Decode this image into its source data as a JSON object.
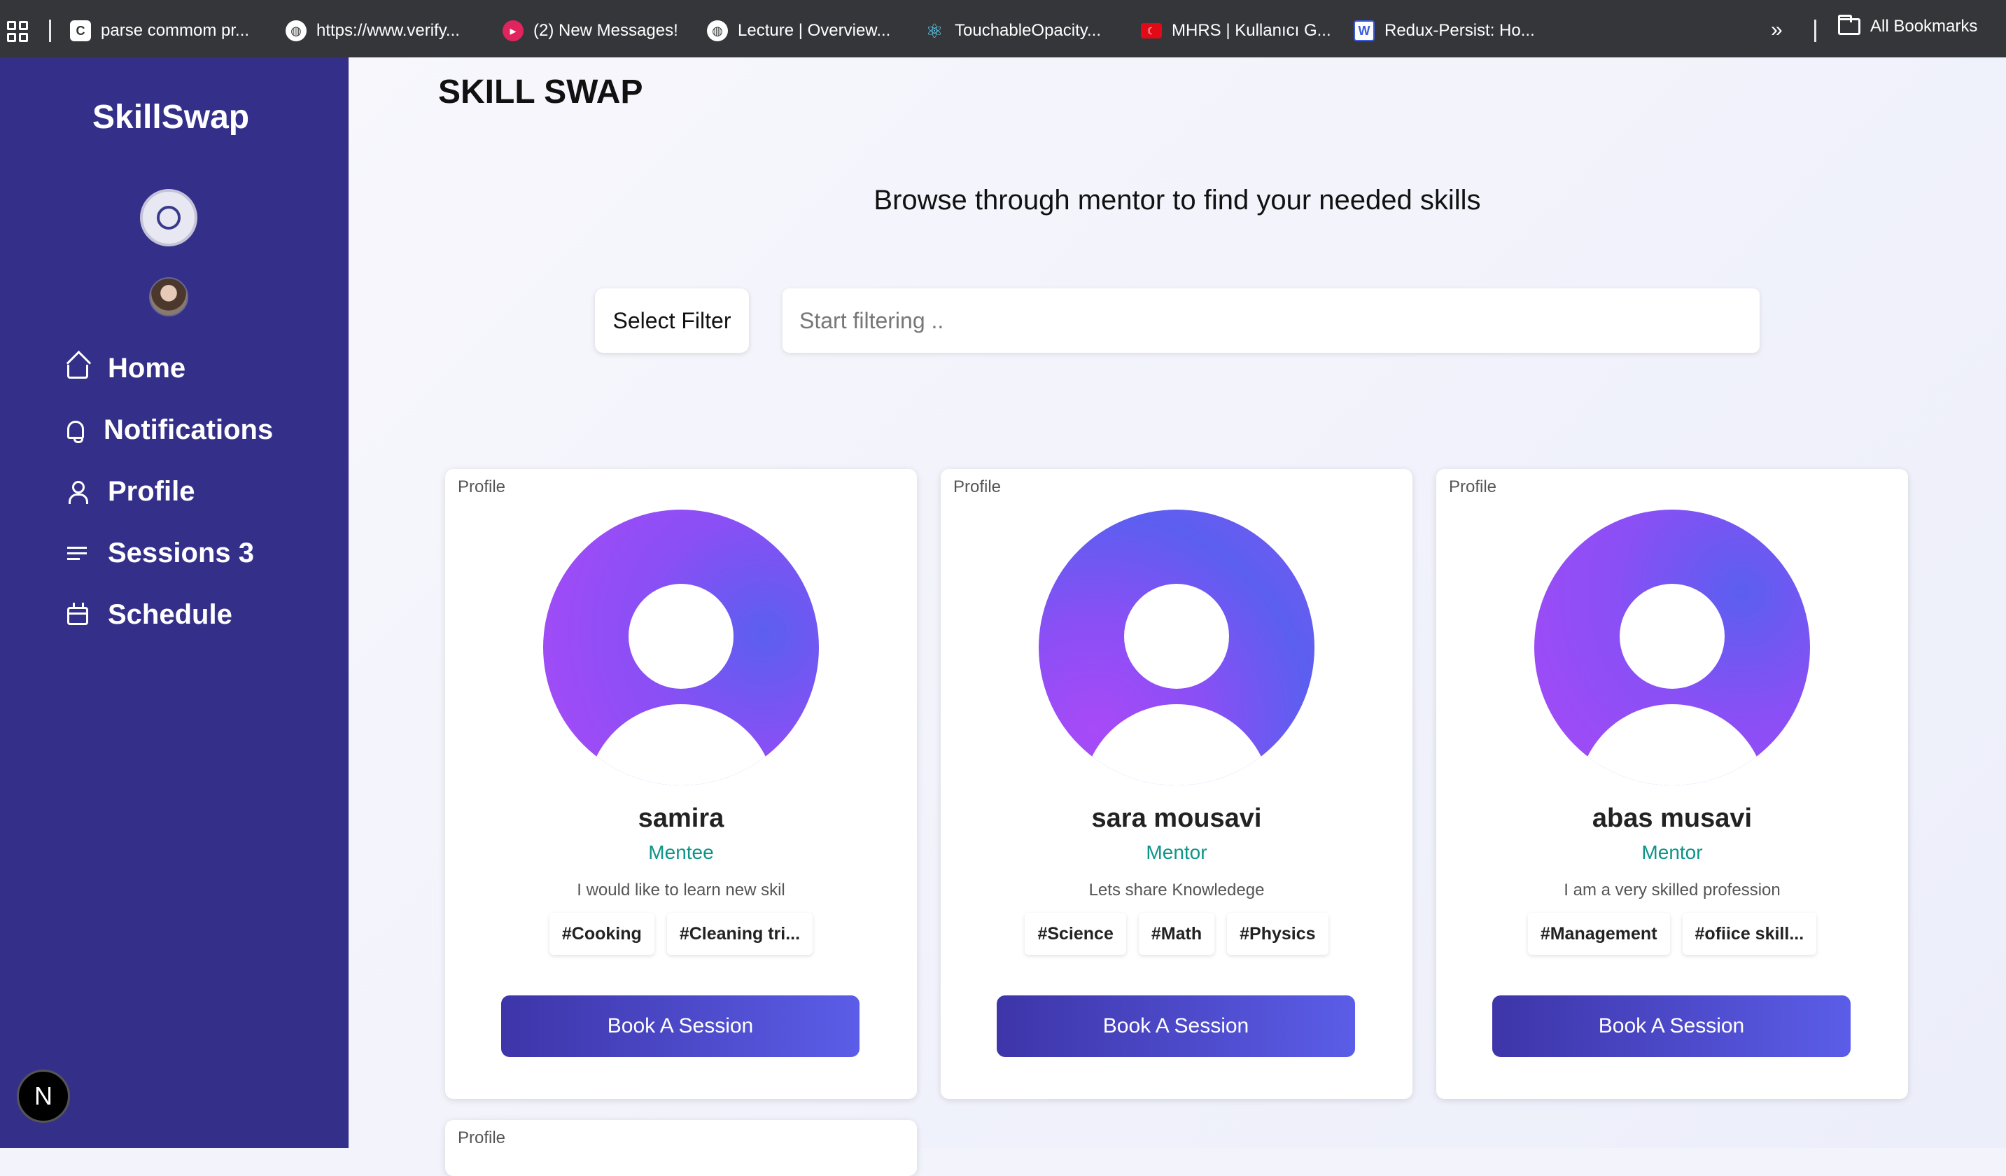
{
  "bookmarks": [
    {
      "label": "parse commom pr...",
      "icon": "c-logo-icon",
      "color": "#ffffff"
    },
    {
      "label": "https://www.verify...",
      "icon": "globe-icon",
      "color": "#ffffff"
    },
    {
      "label": "(2) New Messages!",
      "icon": "messages-icon",
      "color": "#e0245e"
    },
    {
      "label": "Lecture | Overview...",
      "icon": "globe-icon",
      "color": "#ffffff"
    },
    {
      "label": "TouchableOpacity...",
      "icon": "react-icon",
      "color": "#61dafb"
    },
    {
      "label": "MHRS | Kullanıcı G...",
      "icon": "flag-icon",
      "color": "#e30a17"
    },
    {
      "label": "Redux-Persist: Ho...",
      "icon": "w-logo-icon",
      "color": "#3b5bdb"
    }
  ],
  "all_bookmarks": "All Bookmarks",
  "sidebar": {
    "logo": "SkillSwap",
    "nav": [
      {
        "label": "Home",
        "icon": "home-icon"
      },
      {
        "label": "Notifications",
        "icon": "bell-icon"
      },
      {
        "label": "Profile",
        "icon": "user-icon"
      },
      {
        "label": "Sessions 3",
        "icon": "list-icon"
      },
      {
        "label": "Schedule",
        "icon": "calendar-icon"
      }
    ],
    "badge": "N"
  },
  "main": {
    "title": "SKILL SWAP",
    "subtitle": "Browse through mentor to find your needed skills",
    "filter_button": "Select Filter",
    "filter_placeholder": "Start filtering .."
  },
  "cards": [
    {
      "label": "Profile",
      "name": "samira",
      "role": "Mentee",
      "bio": "I would like to learn new skil",
      "tags": [
        "#Cooking",
        "#Cleaning tri..."
      ],
      "button": "Book A Session"
    },
    {
      "label": "Profile",
      "name": "sara mousavi",
      "role": "Mentor",
      "bio": "Lets share Knowledege",
      "tags": [
        "#Science",
        "#Math",
        "#Physics"
      ],
      "button": "Book A Session"
    },
    {
      "label": "Profile",
      "name": "abas musavi",
      "role": "Mentor",
      "bio": "I am a very skilled profession",
      "tags": [
        "#Management",
        "#ofiice skill..."
      ],
      "button": "Book A Session"
    }
  ],
  "partial_card": {
    "label": "Profile"
  },
  "colors": {
    "sidebar": "#343089",
    "accent": "#0d9488",
    "button_start": "#3d35a8",
    "button_end": "#5b5de8"
  }
}
